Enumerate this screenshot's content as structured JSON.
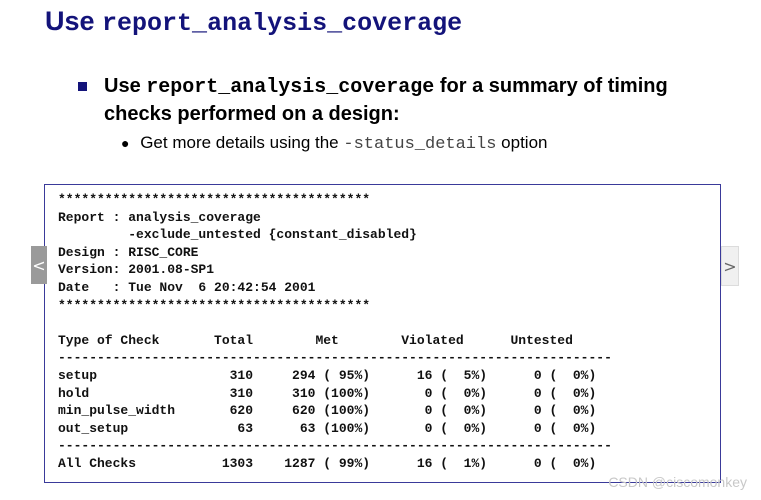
{
  "title": {
    "prefix": "Use",
    "command": "report_analysis_coverage"
  },
  "bullet": {
    "prefix": "Use",
    "command": "report_analysis_coverage",
    "suffix": "for a summary of timing checks performed on a design:"
  },
  "sub_bullet": {
    "prefix": "Get more details using the",
    "option": "-status_details",
    "suffix": "option"
  },
  "report": {
    "lines": [
      "****************************************",
      "Report : analysis_coverage",
      "         -exclude_untested {constant_disabled}",
      "Design : RISC_CORE",
      "Version: 2001.08-SP1",
      "Date   : Tue Nov  6 20:42:54 2001",
      "****************************************",
      "",
      "Type of Check       Total        Met        Violated      Untested",
      "-----------------------------------------------------------------------",
      "setup                 310     294 ( 95%)      16 (  5%)      0 (  0%)",
      "hold                  310     310 (100%)       0 (  0%)      0 (  0%)",
      "min_pulse_width       620     620 (100%)       0 (  0%)      0 (  0%)",
      "out_setup              63      63 (100%)       0 (  0%)      0 (  0%)",
      "-----------------------------------------------------------------------",
      "All Checks           1303    1287 ( 99%)      16 (  1%)      0 (  0%)"
    ]
  },
  "nav": {
    "prev_icon": "chevron-left-icon",
    "next_icon": "chevron-right-icon",
    "prev_glyph": "<",
    "next_glyph": ">"
  },
  "watermark": "CSDN @ciscomonkey",
  "colors": {
    "title": "#13137a",
    "report_border": "#3a3a9a"
  }
}
